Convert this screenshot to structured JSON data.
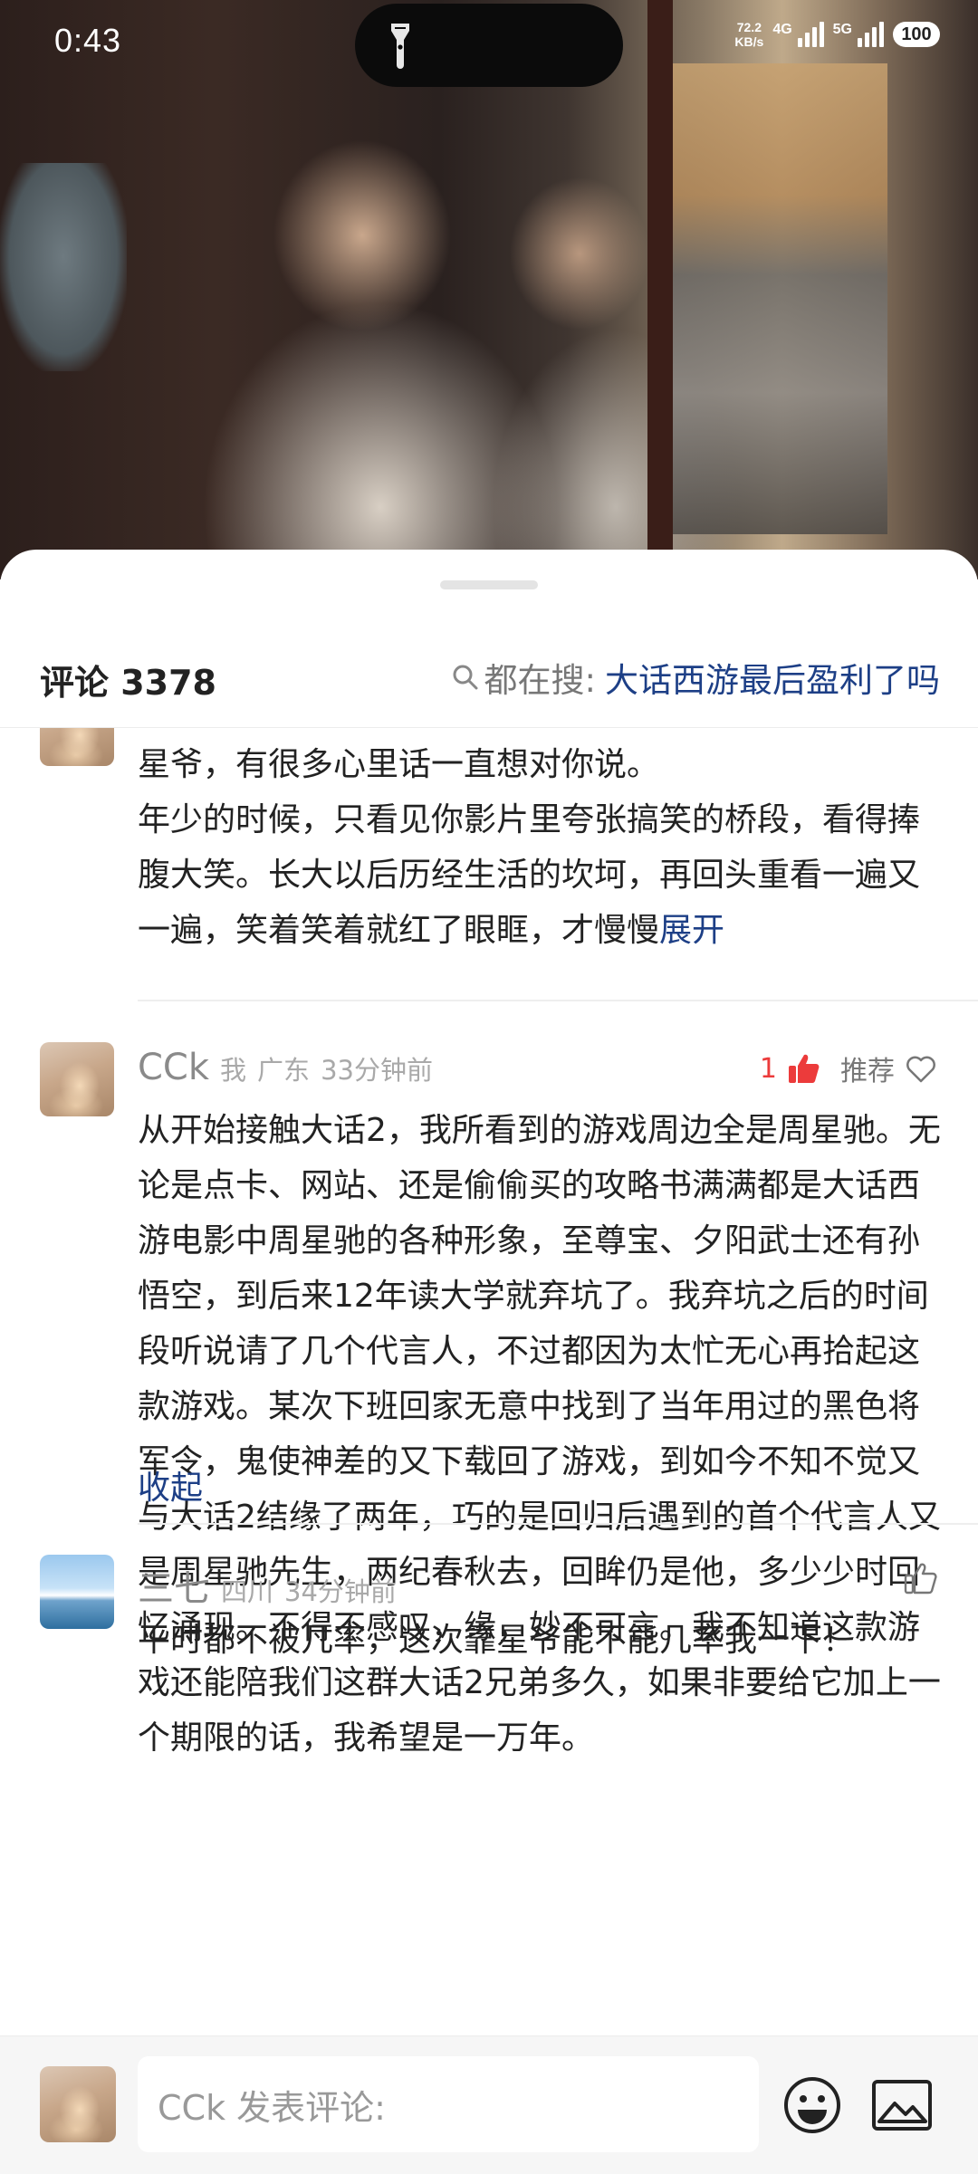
{
  "status_bar": {
    "time": "0:43",
    "net_speed_value": "72.2",
    "net_speed_unit": "KB/s",
    "signal1": "4G",
    "signal2": "5G",
    "battery": "100"
  },
  "comments_header": {
    "title": "评论 3378",
    "hot_search_label": "都在搜:",
    "hot_search_keyword": "大话西游最后盈利了吗"
  },
  "comments": [
    {
      "text": "星爷，有很多心里话一直想对你说。\n年少的时候，只看见你影片里夸张搞笑的桥段，看得捧腹大笑。长大以后历经生活的坎坷，再回头重看一遍又一遍，笑着笑着就红了眼眶，才慢慢",
      "expand_label": "展开"
    },
    {
      "user": "CCk",
      "self_tag": "我",
      "location": "广东",
      "time": "33分钟前",
      "likes": "1",
      "recommend_label": "推荐",
      "text": "从开始接触大话2，我所看到的游戏周边全是周星驰。无论是点卡、网站、还是偷偷买的攻略书满满都是大话西游电影中周星驰的各种形象，至尊宝、夕阳武士还有孙悟空，到后来12年读大学就弃坑了。我弃坑之后的时间段听说请了几个代言人，不过都因为太忙无心再拾起这款游戏。某次下班回家无意中找到了当年用过的黑色将军令，鬼使神差的又下载回了游戏，到如今不知不觉又与大话2结缘了两年，巧的是回归后遇到的首个代言人又是周星驰先生，两纪春秋去，回眸仍是他，多少少时回忆涌现。不得不感叹，缘，妙不可言。我不知道这款游戏还能陪我们这群大话2兄弟多久，如果非要给它加上一个期限的话，我希望是一万年。",
      "collapse_label": "收起"
    },
    {
      "user": "三七",
      "location": "四川",
      "time": "34分钟前",
      "text": "平时都不被几率，这次靠星爷能不能几率我一下！"
    }
  ],
  "bottom_bar": {
    "placeholder": "CCk 发表评论:"
  },
  "colors": {
    "link_blue": "#1d3f86",
    "like_red": "#ec3b3b"
  },
  "icons": [
    "flashlight-icon",
    "search-icon",
    "thumb-up-filled-icon",
    "heart-outline-icon",
    "thumb-up-outline-icon",
    "emoji-icon",
    "image-icon"
  ]
}
